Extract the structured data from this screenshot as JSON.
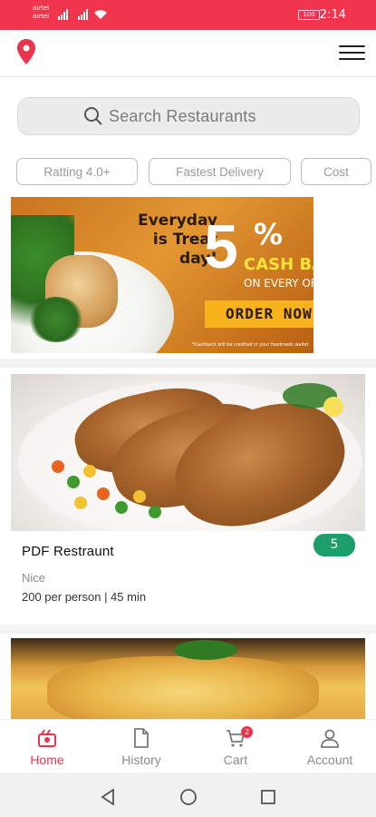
{
  "status_bar": {
    "carrier_1": "airtel",
    "carrier_2": "airtel",
    "battery": "100",
    "time": "2:14"
  },
  "header": {
    "location_icon": "map-pin-icon",
    "menu_icon": "hamburger-menu-icon"
  },
  "search": {
    "placeholder": "Search Restaurants",
    "icon": "search-icon"
  },
  "filters": [
    {
      "label": "Ratting 4.0+"
    },
    {
      "label": "Fastest Delivery"
    },
    {
      "label": "Cost"
    }
  ],
  "banner": {
    "line1": "Everyday",
    "line2": "is Treat day!",
    "percent": "5",
    "percent_sign": "%",
    "cashback": "CASH BAC",
    "subline": "ON EVERY ORD",
    "cta": "ORDER NOW",
    "fine_print": "*Cashback will be credited in your foodmeds wallet"
  },
  "restaurants": [
    {
      "name": "PDF Restraunt",
      "rating": "5",
      "description": "Nice",
      "meta": "200 per person | 45 min"
    }
  ],
  "tabs": [
    {
      "label": "Home",
      "icon": "home-food-icon",
      "active": true
    },
    {
      "label": "History",
      "icon": "document-icon",
      "active": false
    },
    {
      "label": "Cart",
      "icon": "cart-icon",
      "active": false,
      "badge": "2"
    },
    {
      "label": "Account",
      "icon": "user-icon",
      "active": false
    }
  ],
  "colors": {
    "accent": "#f0354d",
    "rating_green": "#1e9e6a"
  }
}
